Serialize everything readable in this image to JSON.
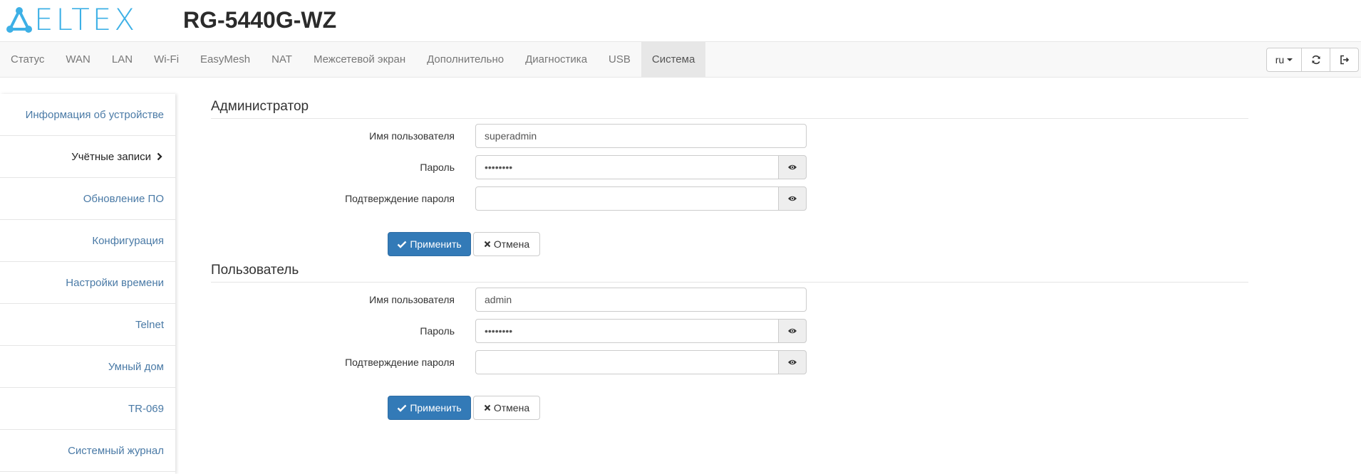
{
  "brand": {
    "logo_text": "ELTEX",
    "model": "RG-5440G-WZ",
    "logo_color": "#3db0e6"
  },
  "nav": {
    "tabs": [
      {
        "label": "Статус"
      },
      {
        "label": "WAN"
      },
      {
        "label": "LAN"
      },
      {
        "label": "Wi-Fi"
      },
      {
        "label": "EasyMesh"
      },
      {
        "label": "NAT"
      },
      {
        "label": "Межсетевой экран"
      },
      {
        "label": "Дополнительно"
      },
      {
        "label": "Диагностика"
      },
      {
        "label": "USB"
      },
      {
        "label": "Система",
        "active": true
      }
    ],
    "language": "ru",
    "refresh_icon": "refresh-icon",
    "logout_icon": "logout-icon"
  },
  "sidebar": {
    "items": [
      {
        "label": "Информация об устройстве"
      },
      {
        "label": "Учётные записи",
        "active": true
      },
      {
        "label": "Обновление ПО"
      },
      {
        "label": "Конфигурация"
      },
      {
        "label": "Настройки времени"
      },
      {
        "label": "Telnet"
      },
      {
        "label": "Умный дом"
      },
      {
        "label": "TR-069"
      },
      {
        "label": "Системный журнал"
      }
    ]
  },
  "admin": {
    "title": "Администратор",
    "username_label": "Имя пользователя",
    "username_value": "superadmin",
    "password_label": "Пароль",
    "password_value": "••••••••",
    "confirm_label": "Подтверждение пароля",
    "confirm_value": "",
    "apply_label": "Применить",
    "cancel_label": "Отмена"
  },
  "user": {
    "title": "Пользователь",
    "username_label": "Имя пользователя",
    "username_value": "admin",
    "password_label": "Пароль",
    "password_value": "••••••••",
    "confirm_label": "Подтверждение пароля",
    "confirm_value": "",
    "apply_label": "Применить",
    "cancel_label": "Отмена"
  },
  "colors": {
    "primary": "#337ab7",
    "link": "#4a7aa6",
    "nav_active_bg": "#e7e7e7"
  }
}
